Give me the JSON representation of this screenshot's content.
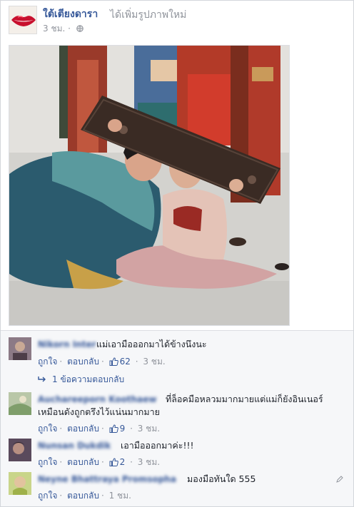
{
  "post": {
    "page_name": "ใต้เตียงดารา",
    "action": "ได้เพิ่มรูปภาพใหม่",
    "time": "3 ชม. ·"
  },
  "icons": {
    "privacy": "globe-icon",
    "like": "thumbs-up-icon",
    "reply_arrow": "reply-arrow-icon",
    "edit": "pencil-icon"
  },
  "colors": {
    "link": "#365899",
    "muted": "#90949c",
    "comment_bg": "#f6f7f9"
  },
  "comments": [
    {
      "name": "Nikorn Inter",
      "text": "แม่เอามือออกมาได้ข้างนึงนะ",
      "like": "ถูกใจ",
      "reply": "ตอบกลับ",
      "likes": "62",
      "time": "3 ชม."
    },
    {
      "name": "Auchareeporn Koothaew",
      "text": "ที่ล็อคมือหลวมมากมายแต่แม่ก็ยังอินเนอร์เหมือนดังถูกตรึงไว้แน่นมากมาย",
      "like": "ถูกใจ",
      "reply": "ตอบกลับ",
      "likes": "9",
      "time": "3 ชม."
    },
    {
      "name": "Nunsan Dukdik",
      "text": "เอามือออกมาค่ะ!!!",
      "like": "ถูกใจ",
      "reply": "ตอบกลับ",
      "likes": "2",
      "time": "3 ชม."
    },
    {
      "name": "Neyne Bhattraya Promsopha",
      "text": "มองมือทันใด 555",
      "like": "ถูกใจ",
      "reply": "ตอบกลับ",
      "time": "1 ชม."
    }
  ],
  "replies": {
    "label": "1 ข้อความตอบกลับ"
  }
}
